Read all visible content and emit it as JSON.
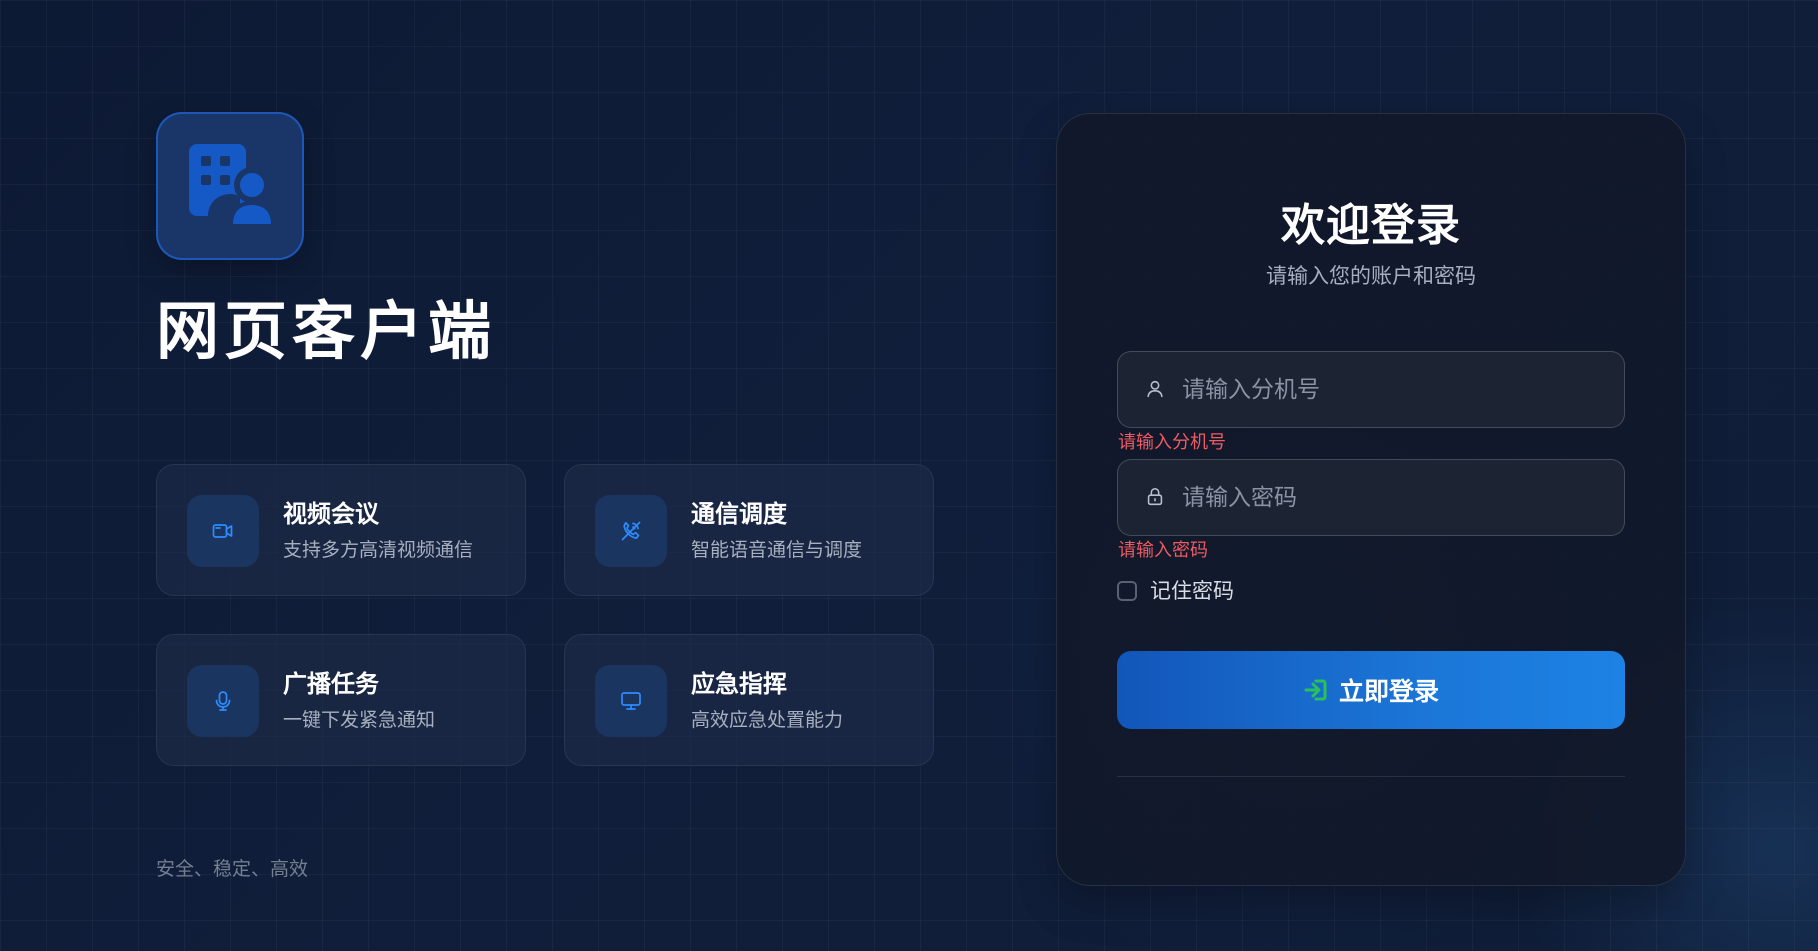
{
  "theme": {
    "accent": "#1d82e5",
    "accent_dark": "#1256b9",
    "error": "#ef5b63",
    "success_icon": "#29c25a",
    "card_bg": "#11182b"
  },
  "brand": {
    "logo_icon": "building-user-icon",
    "app_title": "网页客户端"
  },
  "features": [
    {
      "icon": "video-camera-icon",
      "title": "视频会议",
      "description": "支持多方高清视频通信"
    },
    {
      "icon": "phone-dispatch-icon",
      "title": "通信调度",
      "description": "智能语音通信与调度"
    },
    {
      "icon": "microphone-icon",
      "title": "广播任务",
      "description": "一键下发紧急通知"
    },
    {
      "icon": "monitor-icon",
      "title": "应急指挥",
      "description": "高效应急处置能力"
    }
  ],
  "tagline": "安全、稳定、高效",
  "login": {
    "title": "欢迎登录",
    "subtitle": "请输入您的账户和密码",
    "phone": {
      "icon": "user-icon",
      "placeholder": "请输入分机号",
      "value": "",
      "error": "请输入分机号"
    },
    "password": {
      "icon": "lock-icon",
      "placeholder": "请输入密码",
      "value": "",
      "error": "请输入密码"
    },
    "remember": {
      "label": "记住密码",
      "checked": false
    },
    "button": {
      "icon": "login-arrow-icon",
      "label": "立即登录"
    }
  }
}
